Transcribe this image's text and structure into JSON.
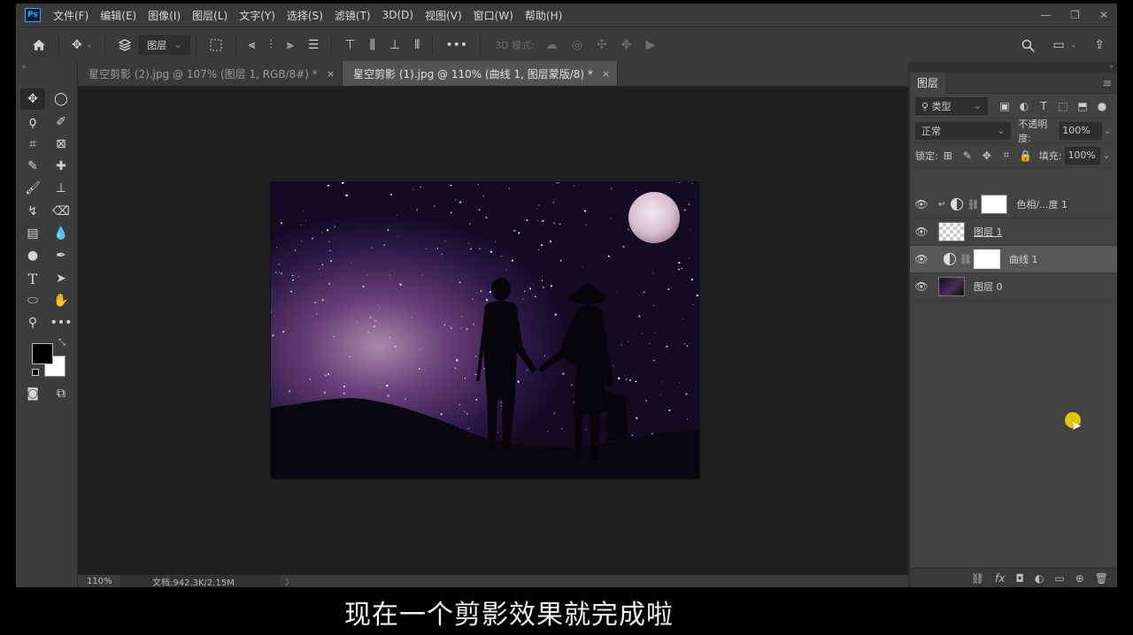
{
  "menubar": {
    "logo": "Ps",
    "items": [
      "文件(F)",
      "编辑(E)",
      "图像(I)",
      "图层(L)",
      "文字(Y)",
      "选择(S)",
      "滤镜(T)",
      "3D(D)",
      "视图(V)",
      "窗口(W)",
      "帮助(H)"
    ],
    "window_controls": [
      "minimize-icon",
      "restore-icon",
      "close-icon"
    ]
  },
  "optionsbar": {
    "auto_select_target": "图层",
    "mode_3d_label": "3D 模式:",
    "icons": [
      "home-icon",
      "move-icon",
      "auto-select-icon",
      "transform-controls-icon",
      "align-left-icon",
      "align-center-icon",
      "align-right-icon",
      "distribute-icon",
      "align-top-icon",
      "align-middle-icon",
      "align-bottom-icon",
      "distribute-vertical-icon",
      "more-icon",
      "orbit-3d-icon",
      "roll-3d-icon",
      "drag-3d-icon",
      "slide-3d-icon",
      "camera-3d-icon",
      "search-icon",
      "workspace-icon",
      "share-icon"
    ]
  },
  "tabs": [
    {
      "label": "星空剪影 (2).jpg @ 107% (图层 1, RGB/8#) *",
      "close": "×",
      "active": false
    },
    {
      "label": "星空剪影 (1).jpg @ 110% (曲线 1, 图层蒙版/8) *",
      "close": "×",
      "active": true
    }
  ],
  "statusbar": {
    "zoom": "110%",
    "doc_info": "文档:942.3K/2.15M",
    "arrow": "〉"
  },
  "layers_panel": {
    "title": "图层",
    "filter_label": "类型",
    "blend_mode": "正常",
    "opacity_label": "不透明度:",
    "opacity_value": "100%",
    "lock_label": "锁定:",
    "fill_label": "填充:",
    "fill_value": "100%",
    "layers": [
      {
        "name": "色相/...度 1",
        "kind": "adjustment-clipped",
        "visible": true
      },
      {
        "name": "图层 1",
        "kind": "pixel",
        "visible": true
      },
      {
        "name": "曲线 1",
        "kind": "adjustment",
        "visible": true,
        "selected": true
      },
      {
        "name": "图层 0",
        "kind": "pixel",
        "visible": true
      }
    ]
  },
  "tools": [
    "move-tool",
    "marquee-tool",
    "lasso-tool",
    "quick-select-tool",
    "crop-tool",
    "frame-tool",
    "eyedropper-tool",
    "healing-tool",
    "brush-tool",
    "stamp-tool",
    "history-brush-tool",
    "eraser-tool",
    "gradient-tool",
    "blur-tool",
    "dodge-tool",
    "pen-tool",
    "type-tool",
    "path-select-tool",
    "shape-tool",
    "hand-tool",
    "zoom-tool",
    "more-tools"
  ],
  "colors": {
    "foreground": "#000000",
    "background": "#ffffff",
    "accent": "#31a8ff",
    "cursor_highlight": "#f5d400"
  },
  "subtitle": "现在一个剪影效果就完成啦"
}
